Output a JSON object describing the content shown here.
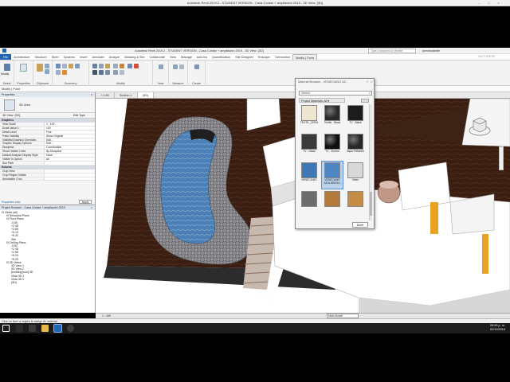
{
  "window": {
    "title": "Autodesk Revit 2019.2 - STUDENT VERSION - Casa Contaz + ampliación 2019 - 3D View: {3D}",
    "search_placeholder": "Type a keyword or phrase",
    "user": "jannetcastrille"
  },
  "menu": {
    "tabs": [
      "File",
      "Architecture",
      "Structure",
      "Steel",
      "Systems",
      "Insert",
      "Annotate",
      "Analyze",
      "Massing & Site",
      "Collaborate",
      "View",
      "Manage",
      "Add-Ins",
      "Quantification",
      "Site Designer",
      "Enscape",
      "Twinmotion",
      "Modify | Point"
    ],
    "file_label": "File",
    "active_tab": "Modify | Point"
  },
  "ribbon": {
    "groups": [
      "Select",
      "Properties",
      "Clipboard",
      "Geometry",
      "Modify",
      "View",
      "Measure",
      "Create"
    ],
    "modify_btn": "Modify",
    "paste_btn": "Paste"
  },
  "modify_bar": "Modify | Point",
  "properties": {
    "panel_title": "Properties",
    "type_name": "3D View",
    "instance_selector": "3D View: {3D}",
    "edit_type": "Edit Type",
    "sections": [
      {
        "name": "Graphics",
        "rows": [
          [
            "View Scale",
            "1 : 100"
          ],
          [
            "Scale Value 1:",
            "100"
          ],
          [
            "Detail Level",
            "Fine"
          ],
          [
            "Parts Visibility",
            "Show Original"
          ],
          [
            "Visibility/Graphics Overrides",
            "Edit..."
          ],
          [
            "Graphic Display Options",
            "Edit..."
          ],
          [
            "Discipline",
            "Coordination"
          ],
          [
            "Show Hidden Lines",
            "By Discipline"
          ],
          [
            "Default Analysis Display Style",
            "None"
          ],
          [
            "Visible In Option",
            "all"
          ],
          [
            "Sun Path",
            ""
          ]
        ]
      },
      {
        "name": "Extents",
        "rows": [
          [
            "Crop View",
            ""
          ],
          [
            "Crop Region Visible",
            ""
          ],
          [
            "Annotation Crop",
            ""
          ]
        ]
      }
    ],
    "help": "Properties help",
    "apply": "Apply"
  },
  "project_browser": {
    "title": "Project Browser - Casa Contaz + ampliación 2019",
    "items": [
      {
        "text": "Views (all)",
        "lvl": 0
      },
      {
        "text": "Structural Plans",
        "lvl": 1
      },
      {
        "text": "Floor Plans",
        "lvl": 1
      },
      {
        "text": "-0.80",
        "lvl": 2
      },
      {
        "text": "+2.45",
        "lvl": 2
      },
      {
        "text": "+2.65",
        "lvl": 2
      },
      {
        "text": "+5.10",
        "lvl": 2
      },
      {
        "text": "+5.20",
        "lvl": 2
      },
      {
        "text": "Site",
        "lvl": 2
      },
      {
        "text": "Ceiling Plans",
        "lvl": 1
      },
      {
        "text": "-0.80",
        "lvl": 2
      },
      {
        "text": "+2.45",
        "lvl": 2
      },
      {
        "text": "+2.65",
        "lvl": 2
      },
      {
        "text": "+5.10",
        "lvl": 2
      },
      {
        "text": "+5.20",
        "lvl": 2
      },
      {
        "text": "3D Views",
        "lvl": 1
      },
      {
        "text": "3D View 1",
        "lvl": 2
      },
      {
        "text": "3D View 2",
        "lvl": 2
      },
      {
        "text": "{building/pool} 3D",
        "lvl": 2
      },
      {
        "text": "Vista 3D 1",
        "lvl": 2
      },
      {
        "text": "Vista 3D 2",
        "lvl": 2
      },
      {
        "text": "{3D}",
        "lvl": 2
      }
    ]
  },
  "view_tabs": [
    "+-0.80",
    "Section 1",
    "{3D}"
  ],
  "material_browser": {
    "title": "Material Browser - VENECIANO AZ...",
    "search": "Venecl",
    "library": "Project Materials: All",
    "materials": [
      {
        "name": "TEXTIL_CREA",
        "color": "#efe6d2"
      },
      {
        "name": "Textile - Black",
        "color": "#2a2a2a"
      },
      {
        "name": "TV - Black",
        "color": "#1c1c1c"
      },
      {
        "name": "TV - Glass",
        "color": "#3a3a3a"
      },
      {
        "name": "TV - Screen",
        "color": "#0e0e0e"
      },
      {
        "name": "Vapor Retarder",
        "color": "#262626"
      },
      {
        "name": "VENECIANO",
        "color": "#3f77b5"
      },
      {
        "name": "VENECIANO AZUL/BUDA 1",
        "color": "#4f86c3"
      },
      {
        "name": "Video",
        "color": "#d8d8d8"
      },
      {
        "name": "",
        "color": "#6c6c6c"
      },
      {
        "name": "",
        "color": "#b47a3c"
      },
      {
        "name": "",
        "color": "#c48c45"
      }
    ],
    "selected_index": 7,
    "done": "Done"
  },
  "view_control": "1 : 100",
  "status": "Click on face or region to assign its material.",
  "status_right": "Main Model",
  "clock": {
    "time": "05:59 p. m.",
    "date": "02/12/2019"
  },
  "colors": {
    "file_tab": "#1e65b5",
    "pool_water": "#4b7fb5",
    "deck": "#3a1e12",
    "slab": "#ffffff",
    "accent_orange": "#e9a21f"
  }
}
